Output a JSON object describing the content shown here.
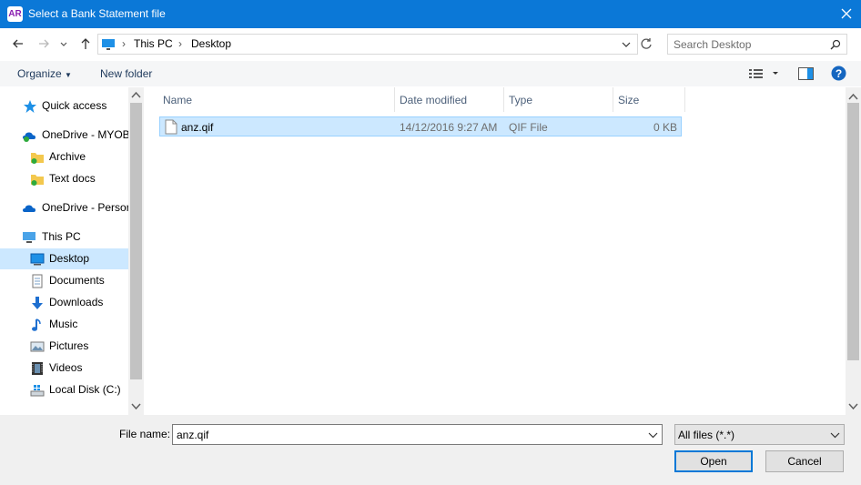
{
  "window": {
    "title": "Select a Bank Statement file",
    "app_icon_text": "AR"
  },
  "address": {
    "crumbs": [
      "This PC",
      "Desktop"
    ]
  },
  "search": {
    "placeholder": "Search Desktop"
  },
  "toolbar": {
    "organize": "Organize",
    "new_folder": "New folder"
  },
  "sidebar": {
    "items": [
      {
        "label": "Quick access",
        "icon": "star-icon"
      },
      {
        "label": "OneDrive - MYOB",
        "icon": "onedrive-icon"
      },
      {
        "label": "Archive",
        "icon": "folder-icon"
      },
      {
        "label": "Text docs",
        "icon": "folder-icon"
      },
      {
        "label": "OneDrive - Persor",
        "icon": "onedrive-icon"
      },
      {
        "label": "This PC",
        "icon": "computer-icon"
      },
      {
        "label": "Desktop",
        "icon": "desktop-icon"
      },
      {
        "label": "Documents",
        "icon": "documents-icon"
      },
      {
        "label": "Downloads",
        "icon": "download-icon"
      },
      {
        "label": "Music",
        "icon": "music-icon"
      },
      {
        "label": "Pictures",
        "icon": "pictures-icon"
      },
      {
        "label": "Videos",
        "icon": "videos-icon"
      },
      {
        "label": "Local Disk (C:)",
        "icon": "disk-icon"
      }
    ]
  },
  "columns": {
    "name": "Name",
    "date": "Date modified",
    "type": "Type",
    "size": "Size"
  },
  "files": [
    {
      "name": "anz.qif",
      "date": "14/12/2016 9:27 AM",
      "type": "QIF File",
      "size": "0 KB"
    }
  ],
  "footer": {
    "file_name_label": "File name:",
    "file_name_value": "anz.qif",
    "filter_value": "All files (*.*)",
    "open_label": "Open",
    "cancel_label": "Cancel"
  },
  "colors": {
    "titlebar": "#0b78d7",
    "selection": "#cce8ff",
    "accent": "#0078d7"
  }
}
